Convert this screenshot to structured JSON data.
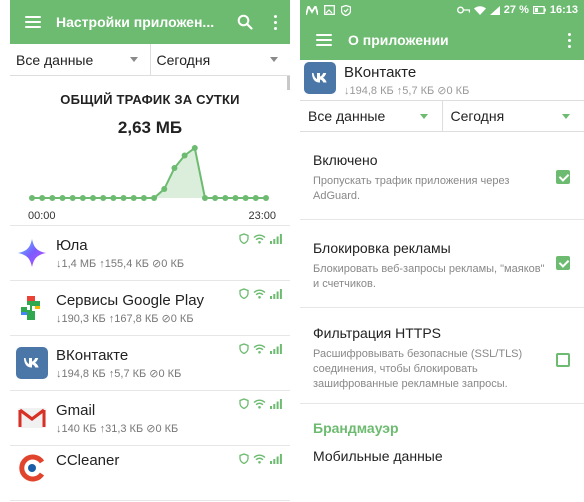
{
  "left": {
    "appbar": {
      "title": "Настройки приложен..."
    },
    "filters": {
      "data_filter": "Все данные",
      "period_filter": "Сегодня"
    },
    "chart": {
      "title": "ОБЩИЙ ТРАФИК ЗА СУТКИ",
      "total": "2,63 МБ",
      "x_start": "00:00",
      "x_end": "23:00"
    },
    "apps": [
      {
        "name": "Юла",
        "stats": "↓1,4 МБ ↑155,4 КБ ⊘0 КБ",
        "icon": "yula-icon"
      },
      {
        "name": "Сервисы Google Play",
        "stats": "↓190,3 КБ ↑167,8 КБ ⊘0 КБ",
        "icon": "google-play-services-icon"
      },
      {
        "name": "ВКонтакте",
        "stats": "↓194,8 КБ ↑5,7 КБ ⊘0 КБ",
        "icon": "vk-icon"
      },
      {
        "name": "Gmail",
        "stats": "↓140 КБ ↑31,3 КБ ⊘0 КБ",
        "icon": "gmail-icon"
      },
      {
        "name": "CCleaner",
        "stats": "",
        "icon": "ccleaner-icon"
      }
    ]
  },
  "right": {
    "statusbar": {
      "battery": "27 %",
      "time": "16:13"
    },
    "appbar": {
      "title": "О приложении"
    },
    "app": {
      "name": "ВКонтакте",
      "stats": "↓194,8 КБ ↑5,7 КБ ⊘0 КБ"
    },
    "filters": {
      "data_filter": "Все данные",
      "period_filter": "Сегодня"
    },
    "settings": [
      {
        "title": "Включено",
        "desc": "Пропускать трафик приложения через AdGuard.",
        "checked": true
      },
      {
        "title": "Блокировка рекламы",
        "desc": "Блокировать веб-запросы рекламы, \"маяков\" и счетчиков.",
        "checked": true
      },
      {
        "title": "Фильтрация HTTPS",
        "desc": "Расшифровывать безопасные (SSL/TLS) соединения, чтобы блокировать зашифрованные рекламные запросы.",
        "checked": false
      }
    ],
    "section_firewall": "Брандмауэр",
    "partial_item": "Мобильные данные"
  },
  "colors": {
    "accent": "#6dbb70",
    "text": "#222222",
    "muted": "#888888"
  },
  "chart_data": {
    "type": "area",
    "title": "ОБЩИЙ ТРАФИК ЗА СУТКИ",
    "x": [
      "00:00",
      "01:00",
      "02:00",
      "03:00",
      "04:00",
      "05:00",
      "06:00",
      "07:00",
      "08:00",
      "09:00",
      "10:00",
      "11:00",
      "12:00",
      "13:00",
      "14:00",
      "15:00",
      "16:00",
      "17:00",
      "18:00",
      "19:00",
      "20:00",
      "21:00",
      "22:00",
      "23:00"
    ],
    "values": [
      0,
      0,
      0,
      0,
      0,
      0,
      0,
      0,
      0,
      0,
      0,
      0,
      0,
      0.18,
      0.6,
      0.85,
      1.0,
      0,
      0,
      0,
      0,
      0,
      0,
      0
    ],
    "x_labels": [
      "00:00",
      "23:00"
    ],
    "grid": false,
    "color": "#6dbb70"
  }
}
